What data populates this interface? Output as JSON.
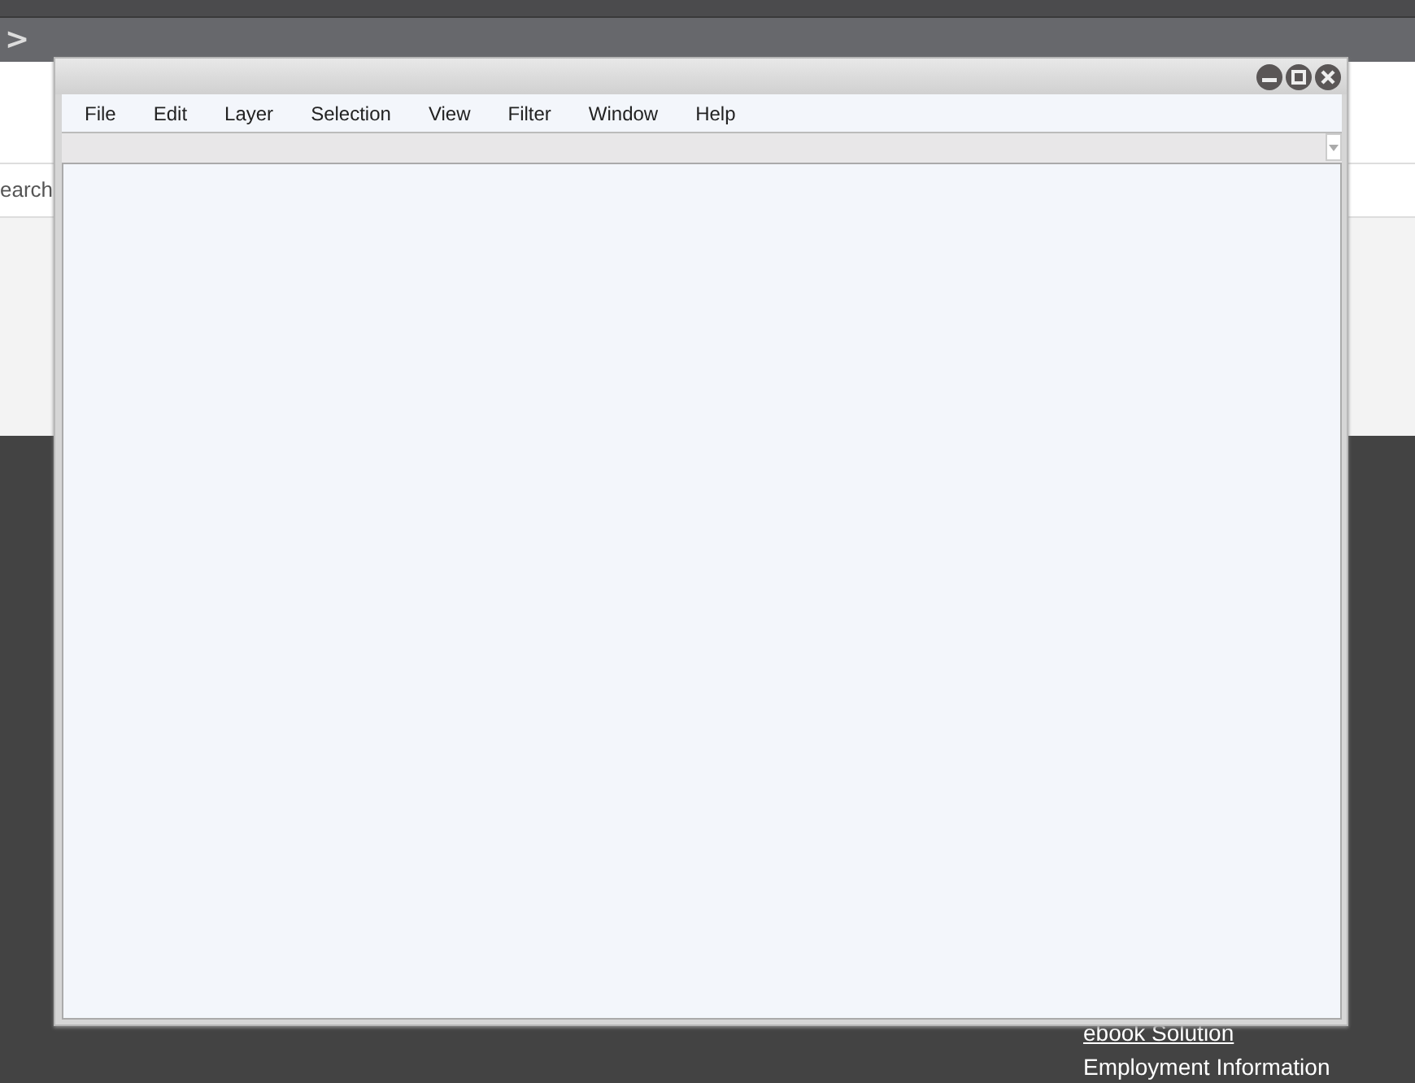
{
  "page": {
    "nav_arrow": ">",
    "search_text": "earch",
    "footer_links": [
      {
        "label": "ebook Solution",
        "kind": "link"
      },
      {
        "label": "Employment Information",
        "kind": "text"
      }
    ]
  },
  "window": {
    "menu": [
      "File",
      "Edit",
      "Layer",
      "Selection",
      "View",
      "Filter",
      "Window",
      "Help"
    ]
  }
}
